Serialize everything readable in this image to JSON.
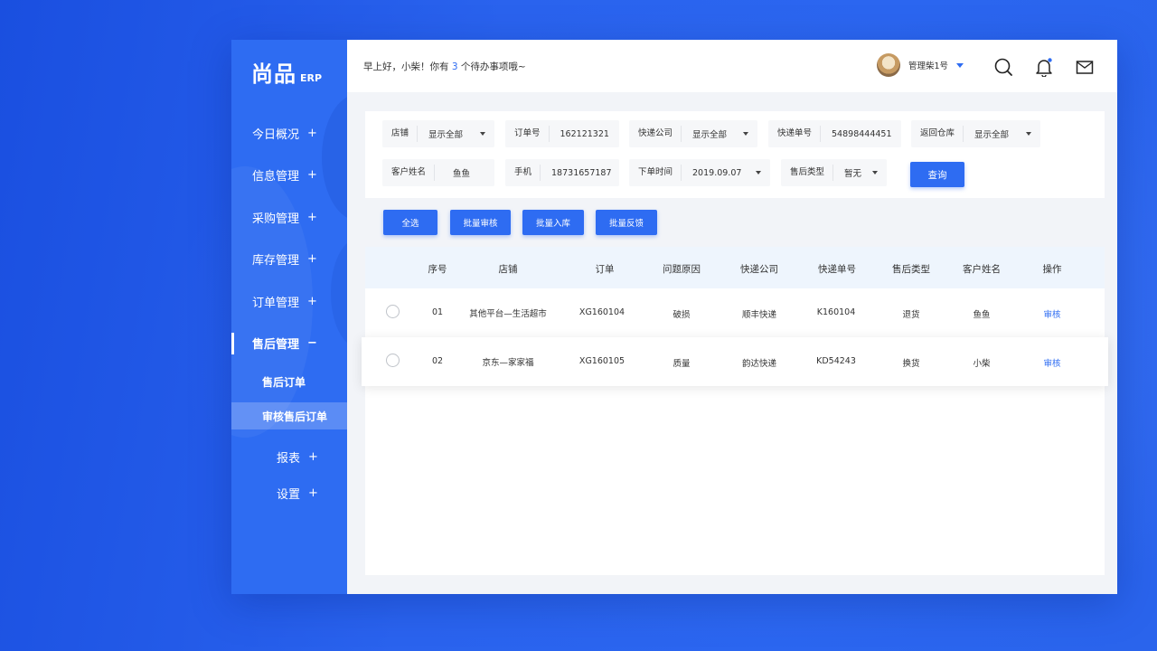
{
  "logo": {
    "brand": "尚品",
    "suffix": "ERP"
  },
  "sidebar": {
    "items": [
      {
        "label": "今日概况",
        "sign": "+"
      },
      {
        "label": "信息管理",
        "sign": "+"
      },
      {
        "label": "采购管理",
        "sign": "+"
      },
      {
        "label": "库存管理",
        "sign": "+"
      },
      {
        "label": "订单管理",
        "sign": "+"
      },
      {
        "label": "售后管理",
        "sign": "−"
      }
    ],
    "subitems": [
      {
        "label": "售后订单"
      },
      {
        "label": "审核售后订单"
      }
    ],
    "bottom_items": [
      {
        "label": "报表",
        "sign": "+"
      },
      {
        "label": "设置",
        "sign": "+"
      }
    ]
  },
  "topbar": {
    "greeting_prefix": "早上好，小柴！你有 ",
    "todo_count": "3",
    "greeting_suffix": " 个待办事项哦~",
    "user_name": "管理柴1号"
  },
  "filters": {
    "shop": {
      "label": "店铺",
      "value": "显示全部"
    },
    "order_no": {
      "label": "订单号",
      "value": "162121321"
    },
    "courier": {
      "label": "快递公司",
      "value": "显示全部"
    },
    "tracking_no": {
      "label": "快递单号",
      "value": "54898444451"
    },
    "warehouse": {
      "label": "返回仓库",
      "value": "显示全部"
    },
    "customer": {
      "label": "客户姓名",
      "value": "鱼鱼"
    },
    "phone": {
      "label": "手机",
      "value": "18731657187"
    },
    "order_time": {
      "label": "下单时间",
      "value": "2019.09.07"
    },
    "after_type": {
      "label": "售后类型",
      "value": "暂无"
    },
    "query_label": "查询"
  },
  "actions": {
    "select_all": "全选",
    "batch_review": "批量审核",
    "batch_stock_in": "批量入库",
    "batch_feedback": "批量反馈"
  },
  "table": {
    "headers": [
      "序号",
      "店铺",
      "订单",
      "问题原因",
      "快递公司",
      "快递单号",
      "售后类型",
      "客户姓名",
      "操作"
    ],
    "rows": [
      [
        "01",
        "其他平台—生活超市",
        "XG160104",
        "破损",
        "顺丰快递",
        "K160104",
        "退货",
        "鱼鱼",
        "审核"
      ],
      [
        "02",
        "京东—家家福",
        "XG160105",
        "质量",
        "韵达快递",
        "KD54243",
        "换货",
        "小柴",
        "审核"
      ]
    ]
  },
  "colors": {
    "accent": "#2e6cf2",
    "sidebar": "#2e6cf2",
    "header_row": "#eef5fd"
  }
}
